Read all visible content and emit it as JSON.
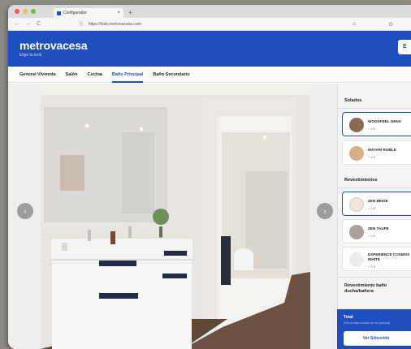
{
  "browser": {
    "tab_title": "Configurador",
    "tab_close": "×",
    "new_tab": "+",
    "back": "←",
    "forward": "→",
    "reload": "C",
    "url": "https://look.metrovacesa.com",
    "toolbar_icon_1": "⌂",
    "toolbar_icon_2": "⊙"
  },
  "header": {
    "logo": "metrovacesa",
    "tagline": "Elige tu look",
    "button_label": "E"
  },
  "tabs": [
    {
      "label": "General Vivienda",
      "active": false
    },
    {
      "label": "Salón",
      "active": false
    },
    {
      "label": "Cocina",
      "active": false
    },
    {
      "label": "Baño Principal",
      "active": true
    },
    {
      "label": "Baño Secundario",
      "active": false
    }
  ],
  "viewer": {
    "prev_icon": "‹",
    "next_icon": "›"
  },
  "sidebar": {
    "soleados_title": "Solados",
    "solados": [
      {
        "name": "WOODFEEL GENA",
        "price": "+ 0 €",
        "color": "#8a6a54",
        "selected": true
      },
      {
        "name": "MAYARI ROBLE",
        "price": "+ 0 €",
        "color": "#d7b08a",
        "selected": false
      }
    ],
    "revestimientos_title": "Revestimientos",
    "revestimientos": [
      {
        "name": "ZEN BEIGE",
        "price": "+ 0 €",
        "color": "#efe6dc",
        "selected": true
      },
      {
        "name": "ZEN TAUPE",
        "price": "+ 0 €",
        "color": "#a8a29c",
        "selected": false
      },
      {
        "name": "EXPERIENCE COSMOS WHITE",
        "price": "+ 0 €",
        "color": "#ececec",
        "selected": false
      }
    ],
    "ducha_title": "Revestimiento baño ducha/bañera"
  },
  "summary": {
    "title": "Total",
    "subtitle": "(IVA no está incluido en los precios)",
    "button": "Ver Selección"
  }
}
